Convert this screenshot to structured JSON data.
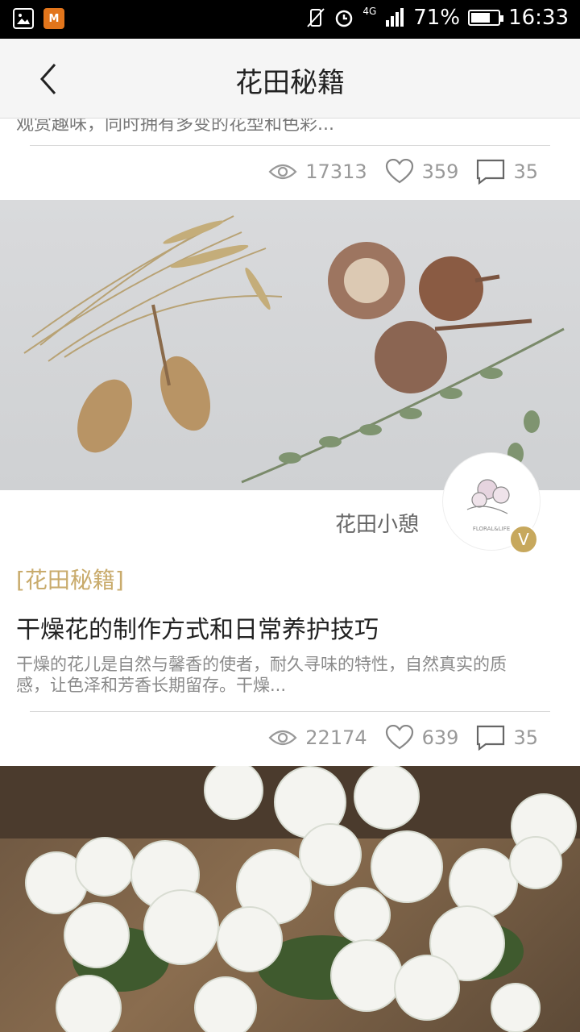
{
  "status_bar": {
    "battery": "71%",
    "time": "16:33",
    "network": "4G",
    "battery_level": 0.71
  },
  "header": {
    "title": "花田秘籍"
  },
  "prev_article": {
    "excerpt_tail": "观赏趣味，同时拥有多变的花型和色彩...",
    "views": "17313",
    "likes": "359",
    "comments": "35"
  },
  "article": {
    "author": "花田小憩",
    "verified_badge": "V",
    "avatar_text": "FLORAL&LIFE",
    "category": "[花田秘籍]",
    "title": "干燥花的制作方式和日常养护技巧",
    "excerpt": "干燥的花儿是自然与馨香的使者，耐久寻味的特性，自然真实的质感，让色泽和芳香长期留存。干燥...",
    "views": "22174",
    "likes": "639",
    "comments": "35"
  },
  "colors": {
    "accent_gold": "#c9ab6c",
    "stat_gray": "#999999"
  }
}
